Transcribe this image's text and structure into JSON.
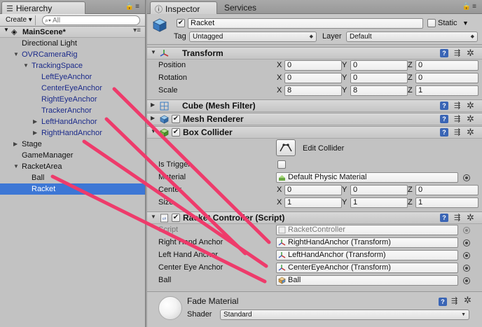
{
  "hierarchy": {
    "tab_label": "Hierarchy",
    "create_label": "Create",
    "search_placeholder": "All",
    "scene_name": "MainScene*",
    "items": [
      {
        "label": "Directional Light"
      },
      {
        "label": "OVRCameraRig"
      },
      {
        "label": "TrackingSpace"
      },
      {
        "label": "LeftEyeAnchor"
      },
      {
        "label": "CenterEyeAnchor"
      },
      {
        "label": "RightEyeAnchor"
      },
      {
        "label": "TrackerAnchor"
      },
      {
        "label": "LeftHandAnchor"
      },
      {
        "label": "RightHandAnchor"
      },
      {
        "label": "Stage"
      },
      {
        "label": "GameManager"
      },
      {
        "label": "RacketArea"
      },
      {
        "label": "Ball"
      },
      {
        "label": "Racket"
      }
    ]
  },
  "inspector": {
    "tab_label": "Inspector",
    "services_tab": "Services",
    "object_name": "Racket",
    "static_label": "Static",
    "tag_label": "Tag",
    "tag_value": "Untagged",
    "layer_label": "Layer",
    "layer_value": "Default",
    "transform": {
      "title": "Transform",
      "position_label": "Position",
      "rotation_label": "Rotation",
      "scale_label": "Scale",
      "axes": [
        "X",
        "Y",
        "Z"
      ],
      "position": [
        "0",
        "0",
        "0"
      ],
      "rotation": [
        "0",
        "0",
        "0"
      ],
      "scale": [
        "8",
        "8",
        "1"
      ]
    },
    "mesh_filter_title": "Cube (Mesh Filter)",
    "mesh_renderer_title": "Mesh Renderer",
    "box_collider": {
      "title": "Box Collider",
      "edit_collider": "Edit Collider",
      "is_trigger_label": "Is Trigger",
      "material_label": "Material",
      "material_value": "Default Physic Material",
      "center_label": "Center",
      "center": [
        "0",
        "0",
        "0"
      ],
      "size_label": "Size",
      "size": [
        "1",
        "1",
        "1"
      ]
    },
    "racket_controller": {
      "title": "Racket Controller (Script)",
      "script_label": "Script",
      "script_value": "RacketController",
      "right_hand_label": "Right Hand Anchor",
      "right_hand_value": "RightHandAnchor (Transform)",
      "left_hand_label": "Left Hand Anchor",
      "left_hand_value": "LeftHandAnchor (Transform)",
      "center_eye_label": "Center Eye Anchor",
      "center_eye_value": "CenterEyeAnchor (Transform)",
      "ball_label": "Ball",
      "ball_value": "Ball"
    },
    "fade_material": {
      "title": "Fade Material",
      "shader_label": "Shader",
      "shader_value": "Standard"
    }
  },
  "colors": {
    "selection": "#3d77d5",
    "prefab_text": "#1b2a8a",
    "annotation_line": "#ee3b6b"
  },
  "icons": [
    "search-icon",
    "lock-icon",
    "menu-icon",
    "cube-icon",
    "transform-icon",
    "mesh-filter-icon",
    "mesh-renderer-icon",
    "box-collider-icon",
    "script-icon",
    "help-icon",
    "preset-icon",
    "gear-icon",
    "object-picker-icon",
    "material-sphere-icon"
  ]
}
